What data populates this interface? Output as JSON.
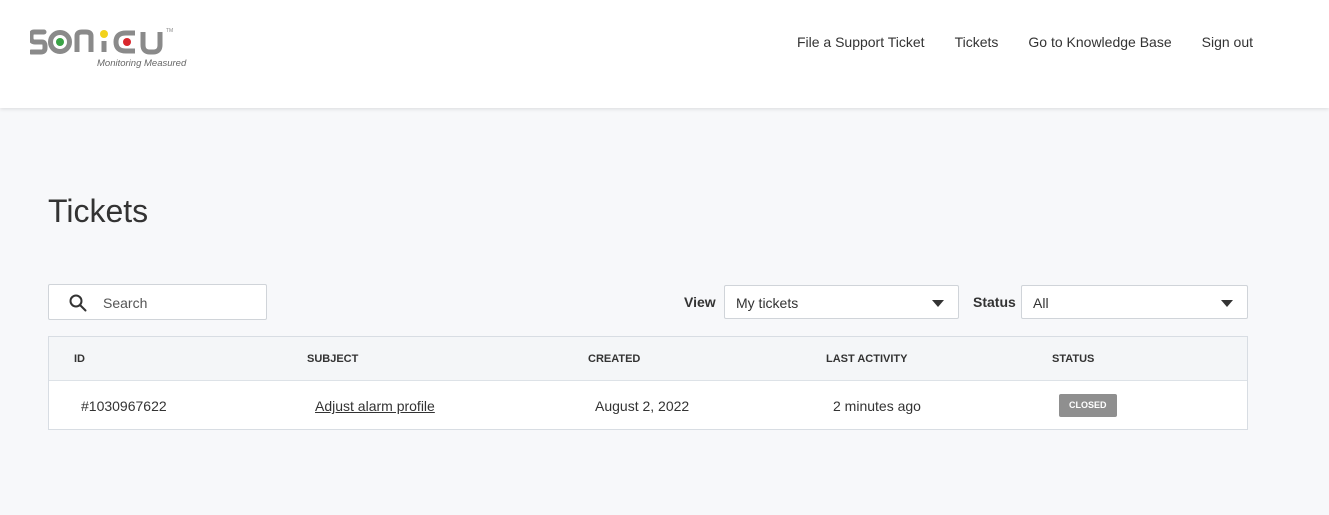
{
  "brand": {
    "name": "SONICU",
    "tagline": "Monitoring Measured",
    "trademark": "TM",
    "colors": {
      "text": "#8a8a8a",
      "green": "#3aa346",
      "yellow": "#f2d21b",
      "red": "#d9262c"
    }
  },
  "nav": {
    "file_ticket": "File a Support Ticket",
    "tickets": "Tickets",
    "knowledge_base": "Go to Knowledge Base",
    "sign_out": "Sign out"
  },
  "page": {
    "title": "Tickets"
  },
  "search": {
    "placeholder": "Search",
    "value": "",
    "icon": "search-icon"
  },
  "filters": {
    "view_label": "View",
    "view_value": "My tickets",
    "status_label": "Status",
    "status_value": "All"
  },
  "table": {
    "columns": [
      "ID",
      "SUBJECT",
      "CREATED",
      "LAST ACTIVITY",
      "STATUS"
    ],
    "rows": [
      {
        "id": "#1030967622",
        "subject": "Adjust alarm profile",
        "created": "August 2, 2022",
        "last_activity": "2 minutes ago",
        "status": "CLOSED"
      }
    ]
  },
  "colors": {
    "page_bg": "#f7f8fa",
    "header_bg": "#ffffff",
    "badge_closed": "#8f8f8f"
  }
}
